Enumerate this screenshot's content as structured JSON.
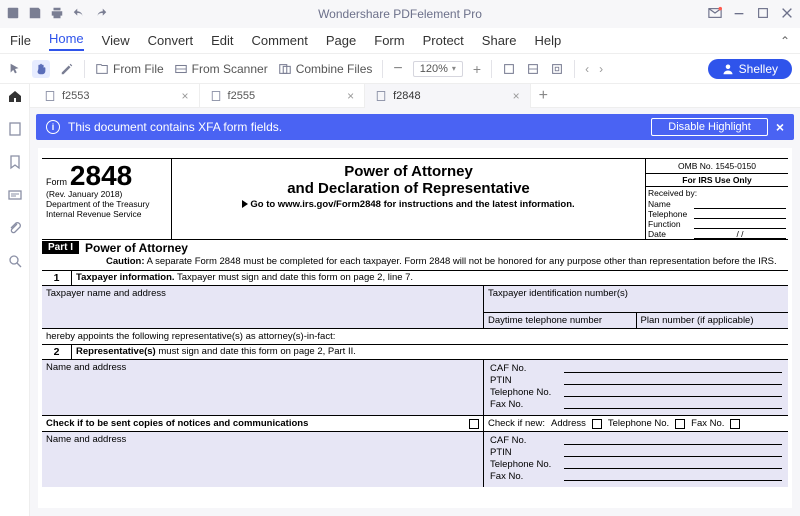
{
  "app": {
    "title": "Wondershare PDFelement Pro"
  },
  "menu": [
    "File",
    "Home",
    "View",
    "Convert",
    "Edit",
    "Comment",
    "Page",
    "Form",
    "Protect",
    "Share",
    "Help"
  ],
  "menu_active": 1,
  "toolbar": {
    "from_file": "From File",
    "from_scanner": "From Scanner",
    "combine": "Combine Files",
    "zoom": "120%",
    "user": "Shelley"
  },
  "tabs": [
    {
      "label": "f2553",
      "active": false
    },
    {
      "label": "f2555",
      "active": false
    },
    {
      "label": "f2848",
      "active": true
    }
  ],
  "notify": {
    "msg": "This document contains XFA form fields.",
    "btn": "Disable Highlight"
  },
  "doc": {
    "form_label": "Form",
    "form_no": "2848",
    "rev": "(Rev. January 2018)",
    "dept1": "Department of the Treasury",
    "dept2": "Internal Revenue Service",
    "title1": "Power of Attorney",
    "title2": "and Declaration of Representative",
    "goto": "Go to www.irs.gov/Form2848 for instructions and the latest information.",
    "omb": "OMB No. 1545-0150",
    "irs_use": "For IRS Use Only",
    "recv": "Received by:",
    "fields_right": [
      "Name",
      "Telephone",
      "Function",
      "Date"
    ],
    "date_sep": "/       /",
    "part1": "Part I",
    "part1_title": "Power of Attorney",
    "caution_label": "Caution:",
    "caution": "A separate Form 2848 must be completed for each taxpayer. Form 2848 will not be honored for any purpose other than representation before the IRS.",
    "sec1_no": "1",
    "sec1_title": "Taxpayer information.",
    "sec1_txt": "Taxpayer must sign and date this form on page 2, line 7.",
    "cell_name": "Taxpayer name and address",
    "cell_tin": "Taxpayer identification number(s)",
    "cell_day": "Daytime telephone number",
    "cell_plan": "Plan number (if applicable)",
    "appoints": "hereby appoints the following representative(s) as attorney(s)-in-fact:",
    "sec2_no": "2",
    "sec2_title": "Representative(s)",
    "sec2_txt": "must sign and date this form on page 2, Part II.",
    "rep_name": "Name and address",
    "rep_fields": [
      "CAF No.",
      "PTIN",
      "Telephone No.",
      "Fax No."
    ],
    "check_send": "Check if to be sent copies of notices and communications",
    "check_new": "Check if new:",
    "check_addr": "Address",
    "check_tel": "Telephone No.",
    "check_fax": "Fax No."
  }
}
